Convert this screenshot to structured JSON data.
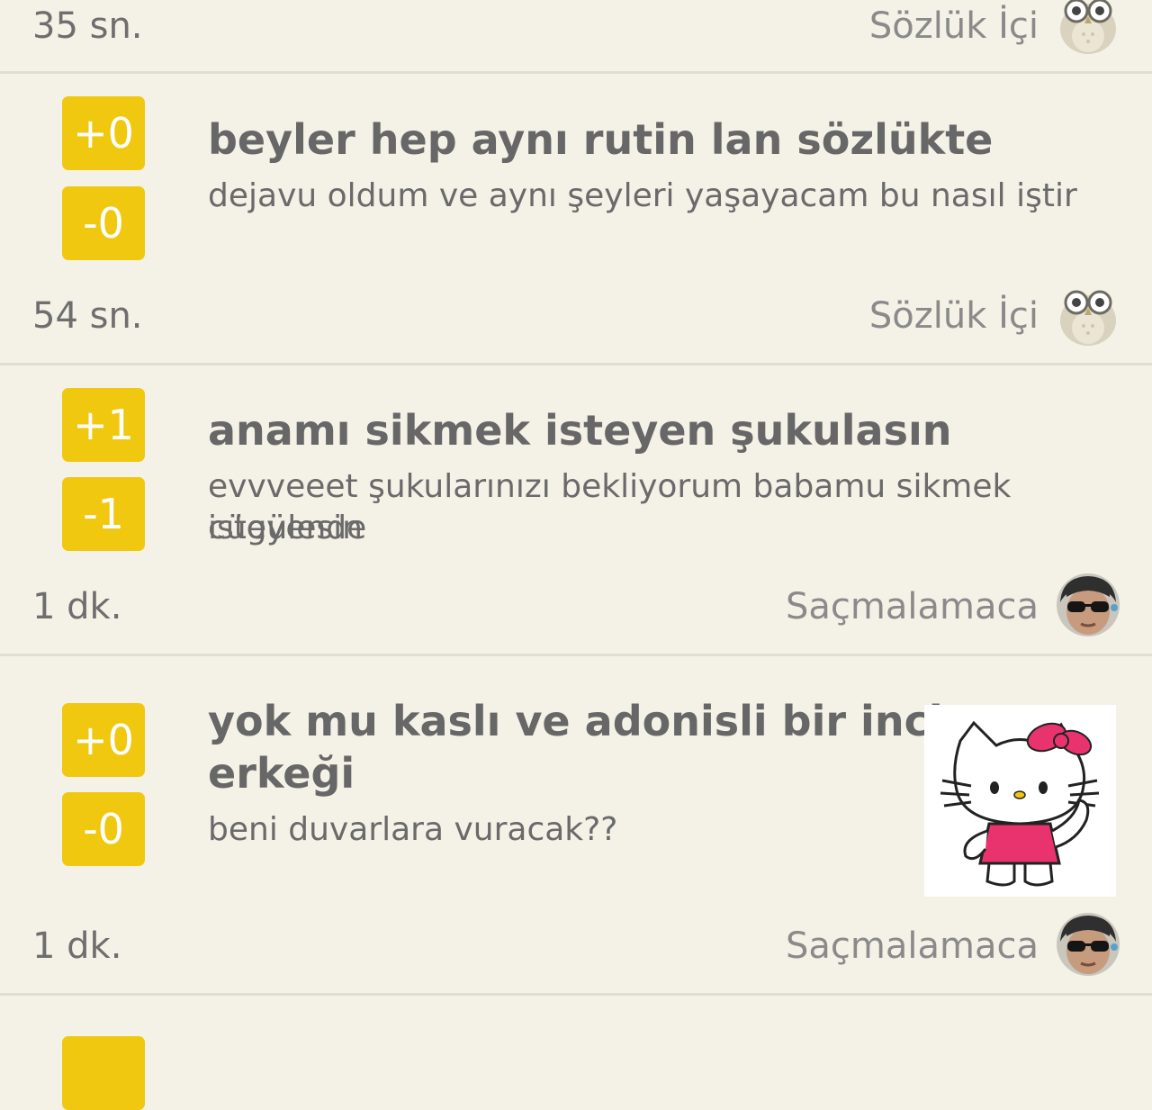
{
  "posts": [
    {
      "time": "35 sn.",
      "author": "Sözlük İçi",
      "avatar_icon": "owl-avatar-icon"
    },
    {
      "up": "+0",
      "down": "-0",
      "title": "beyler hep aynı rutin lan sözlükte",
      "body": "dejavu oldum ve aynı şeyleri yaşayacam bu nasıl iştir",
      "time": "54 sn.",
      "author": "Sözlük İçi",
      "avatar_icon": "owl-avatar-icon"
    },
    {
      "up": "+1",
      "down": "-1",
      "title": "anamı sikmek isteyen şukulasın",
      "body_line1": "evvveeet şukularınızı bekliyorum babamu sikmek isteyende",
      "body_line2": "cügülesin",
      "time": "1 dk.",
      "author": "Saçmalamaca",
      "avatar_icon": "sunglasses-man-avatar-icon"
    },
    {
      "up": "+0",
      "down": "-0",
      "title_line1": "yok mu kaslı ve adonisli bir inci",
      "title_line2": "erkeği",
      "body": "beni duvarlara vuracak??",
      "thumbnail_icon": "hello-kitty-thumbnail-icon",
      "time": "1 dk.",
      "author": "Saçmalamaca",
      "avatar_icon": "sunglasses-man-avatar-icon"
    }
  ],
  "colors": {
    "background": "#f4f1e7",
    "vote_button": "#f0c80f",
    "divider": "#e0ddd5",
    "title": "#676767"
  }
}
